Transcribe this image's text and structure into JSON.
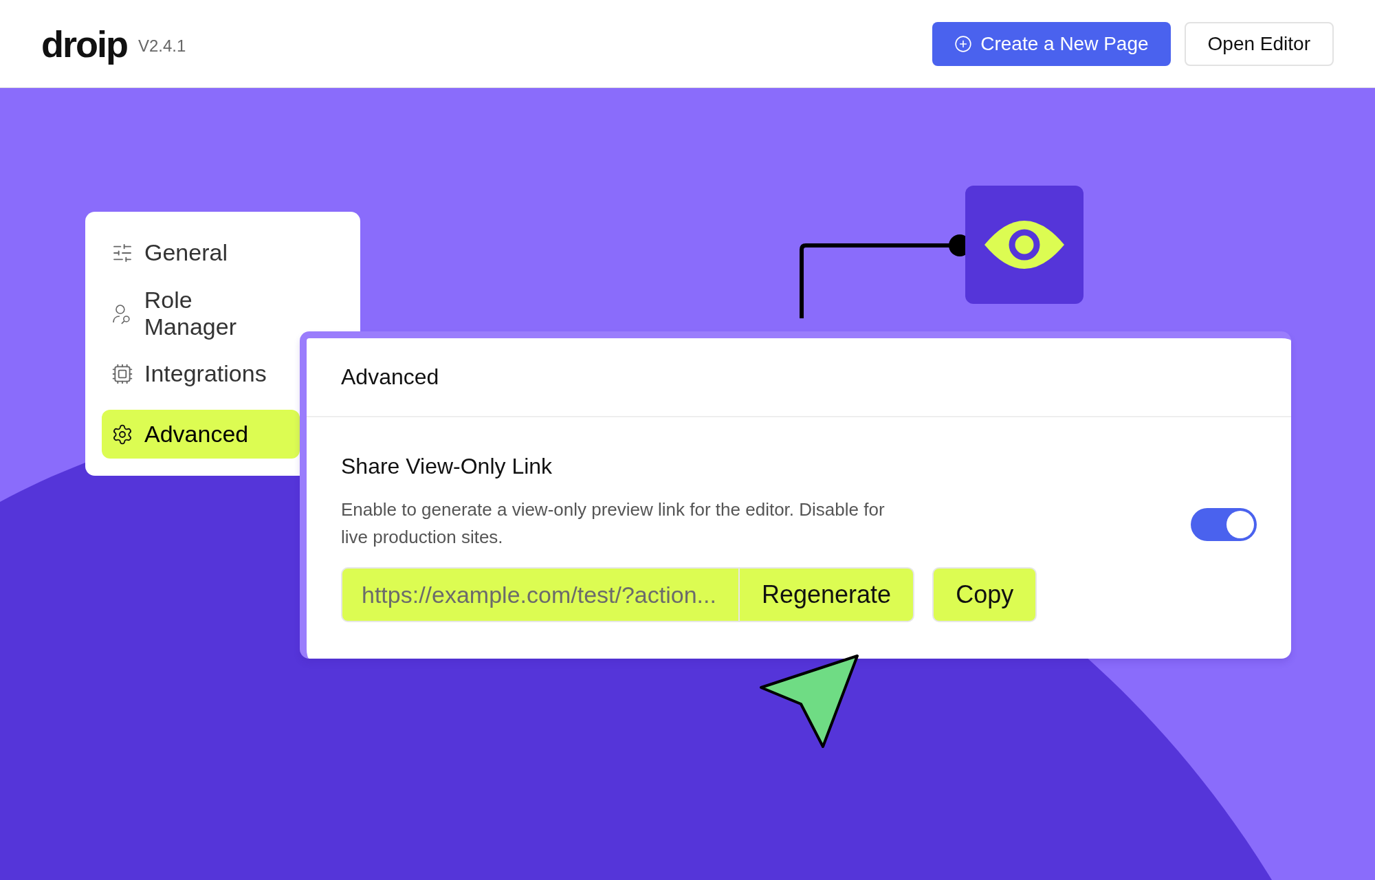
{
  "header": {
    "logo": "droip",
    "version": "V2.4.1",
    "buttons": [
      {
        "label": "Create a New Page",
        "kind": "primary"
      },
      {
        "label": "Open Editor",
        "kind": "secondary"
      }
    ]
  },
  "sidebar": {
    "items": [
      {
        "label": "General",
        "selected": false
      },
      {
        "label": "Role Manager",
        "selected": false
      },
      {
        "label": "Integrations",
        "selected": false
      },
      {
        "label": "Advanced",
        "selected": true
      }
    ]
  },
  "panel": {
    "title": "Advanced",
    "setting": {
      "title": "Share View-Only Link",
      "description": "Enable to generate a view-only preview link for the editor. Disable for live production sites.",
      "on": true,
      "link": "https://example.com/test/?action...",
      "regenerate": "Regenerate",
      "copy": "Copy"
    }
  }
}
